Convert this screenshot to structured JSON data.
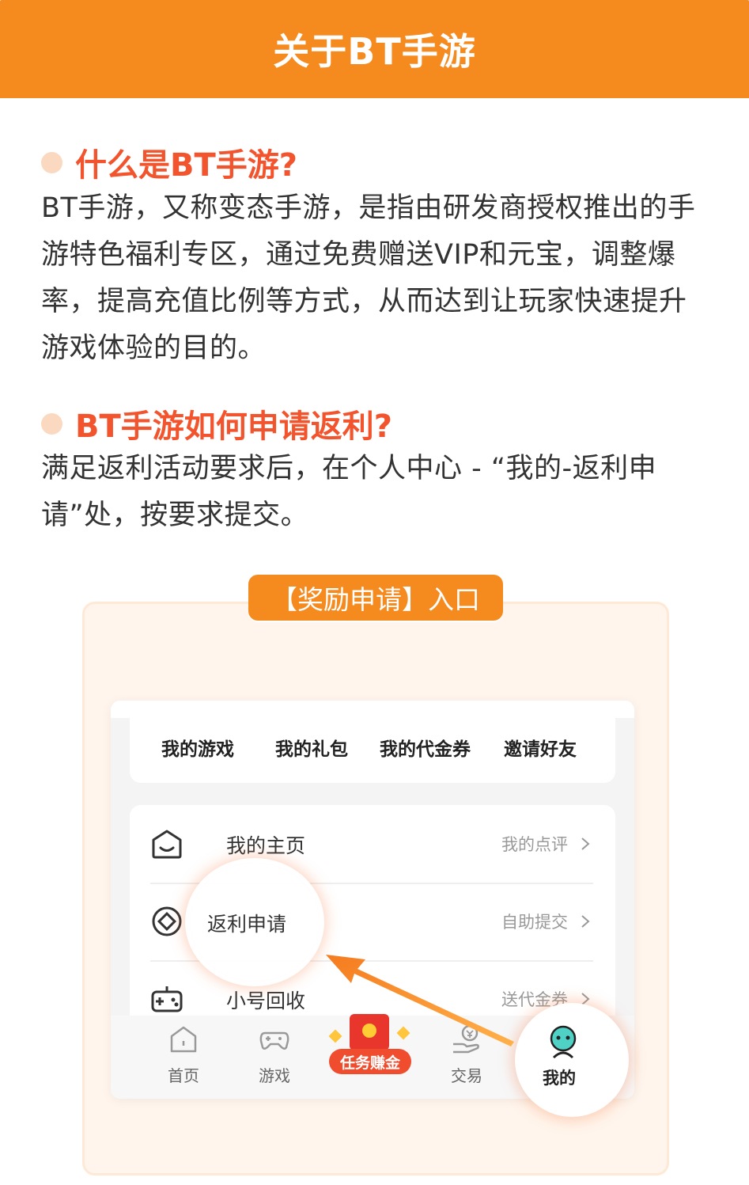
{
  "header": {
    "title": "关于BT手游"
  },
  "sections": [
    {
      "heading": "什么是BT手游?",
      "body": "BT手游，又称变态手游，是指由研发商授权推出的手游特色福利专区，通过免费赠送VIP和元宝，调整爆率，提高充值比例等方式，从而达到让玩家快速提升游戏体验的目的。"
    },
    {
      "heading": "BT手游如何申请返利?",
      "body": "满足返利活动要求后，在个人中心 - “我的-返利申请”处，按要求提交。"
    }
  ],
  "panel": {
    "badge": "【奖励申请】入口"
  },
  "phone": {
    "tabs": [
      "我的游戏",
      "我的礼包",
      "我的代金券",
      "邀请好友"
    ],
    "menu": [
      {
        "label": "我的主页",
        "right": "我的点评",
        "icon": "home-smile-icon"
      },
      {
        "label": "返利申请",
        "right": "自助提交",
        "icon": "rebate-coin-icon"
      },
      {
        "label": "小号回收",
        "right": "送代金券",
        "icon": "gamepad-recycle-icon"
      }
    ],
    "nav": [
      {
        "label": "首页",
        "icon": "home-icon"
      },
      {
        "label": "游戏",
        "icon": "gamepad-icon"
      },
      {
        "label": "任务赚金",
        "icon": "red-envelope-icon"
      },
      {
        "label": "交易",
        "icon": "trade-hand-icon"
      },
      {
        "label": "我的",
        "icon": "smiley-user-icon"
      }
    ]
  },
  "colors": {
    "brand_orange": "#f58a1f",
    "heading_red": "#f2552e",
    "panel_bg": "#fff5ec",
    "bullet": "#fbd8c0"
  }
}
